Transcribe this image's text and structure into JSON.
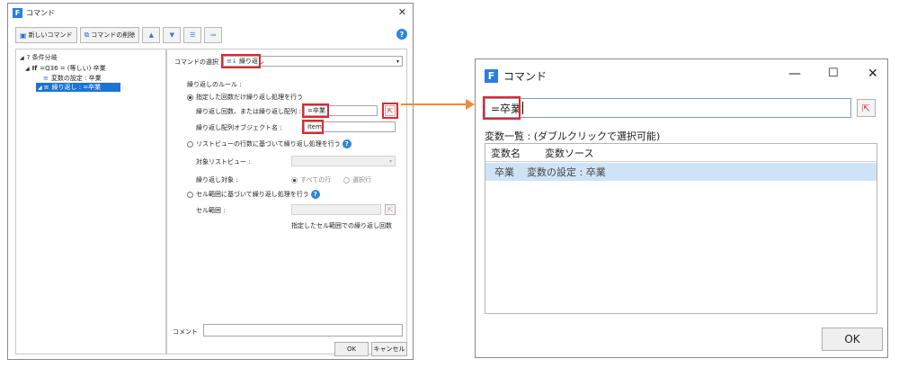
{
  "left_dialog": {
    "title": "コマンド",
    "toolbar": {
      "new_command": "新しいコマンド",
      "delete_command": "コマンドの削除"
    },
    "tree": [
      {
        "text": "? 条件分岐",
        "tag": ""
      },
      {
        "text": "=Q36 = (等しい) 卒業",
        "tag": "If"
      },
      {
        "text": "変数の設定 : 卒業",
        "tag": "≡"
      },
      {
        "text": "繰り返し : =卒業",
        "tag": "≡"
      }
    ],
    "form": {
      "command_select_label": "コマンドの選択 :",
      "command_select_value": "繰り返し",
      "rule_label": "繰り返しのルール :",
      "option1_label": "指定した回数だけ繰り返し処理を行う",
      "count_label": "繰り返し回数、または繰り返し配列 :",
      "count_value": "=卒業",
      "array_obj_label": "繰り返し配列オブジェクト名 :",
      "array_obj_value": "Item",
      "option2_label": "リストビューの行数に基づいて繰り返し処理を行う",
      "target_listview_label": "対象リストビュー :",
      "repeat_target_label": "繰り返し対象 :",
      "all_rows_label": "すべての行",
      "selected_rows_label": "選択行",
      "option3_label": "セル範囲に基づいて繰り返し処理を行う",
      "cell_range_label": "セル範囲 :",
      "cell_range_note": "指定したセル範囲での繰り返し回数",
      "comment_label": "コメント"
    },
    "buttons": {
      "ok": "OK",
      "cancel": "キャンセル"
    }
  },
  "right_dialog": {
    "title": "コマンド",
    "expression_value": "=卒業",
    "list_caption": "変数一覧 : (ダブルクリックで選択可能)",
    "columns": [
      "変数名",
      "変数ソース"
    ],
    "rows": [
      {
        "name": "卒業",
        "source": "変数の設定 : 卒業"
      }
    ],
    "ok": "OK"
  },
  "colors": {
    "accent": "#1b73d6",
    "highlight": "#e0282e",
    "arrow": "#f08a3c"
  }
}
